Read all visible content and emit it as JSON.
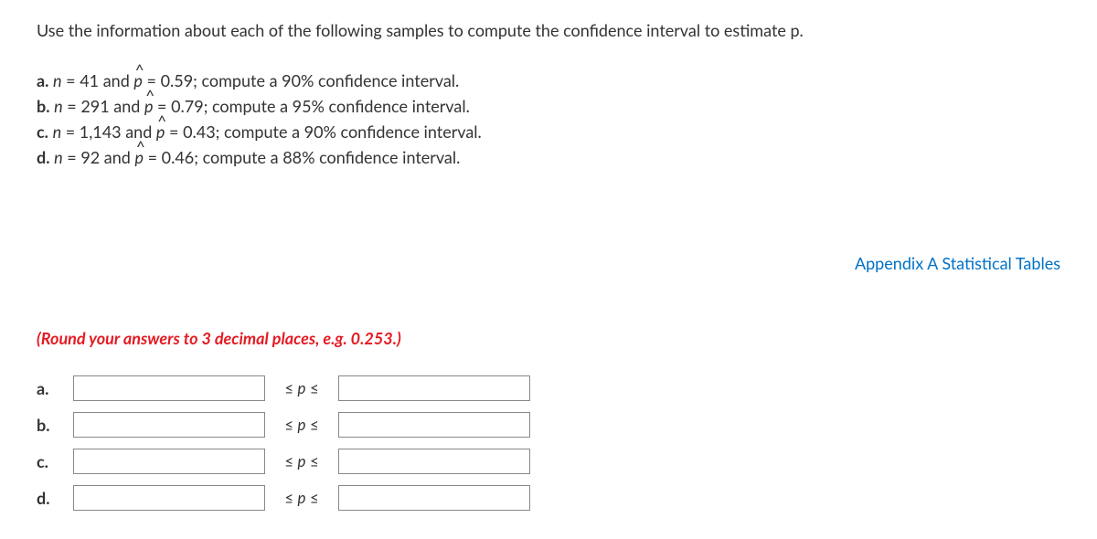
{
  "question": "Use the information about each of the following samples to compute the confidence interval to estimate p.",
  "parts": {
    "a": {
      "label": "a.",
      "n": "41",
      "phat": "0.59",
      "tail": "; compute a 90% confidence interval."
    },
    "b": {
      "label": "b.",
      "n": "291",
      "phat": "0.79",
      "tail": "; compute a 95% confidence interval."
    },
    "c": {
      "label": "c.",
      "n": "1,143",
      "phat": "0.43",
      "tail": "; compute a 90% confidence interval."
    },
    "d": {
      "label": "d.",
      "n": "92",
      "phat": "0.46",
      "tail": "; compute a 88% confidence interval."
    }
  },
  "appendix_link": "Appendix A Statistical Tables",
  "instruction": "(Round your answers to 3 decimal places, e.g. 0.253.)",
  "answers": {
    "a": {
      "label": "a.",
      "rel": "≤ p ≤"
    },
    "b": {
      "label": "b.",
      "rel": "≤ p ≤"
    },
    "c": {
      "label": "c.",
      "rel": "≤ p ≤"
    },
    "d": {
      "label": "d.",
      "rel": "≤ p ≤"
    }
  }
}
